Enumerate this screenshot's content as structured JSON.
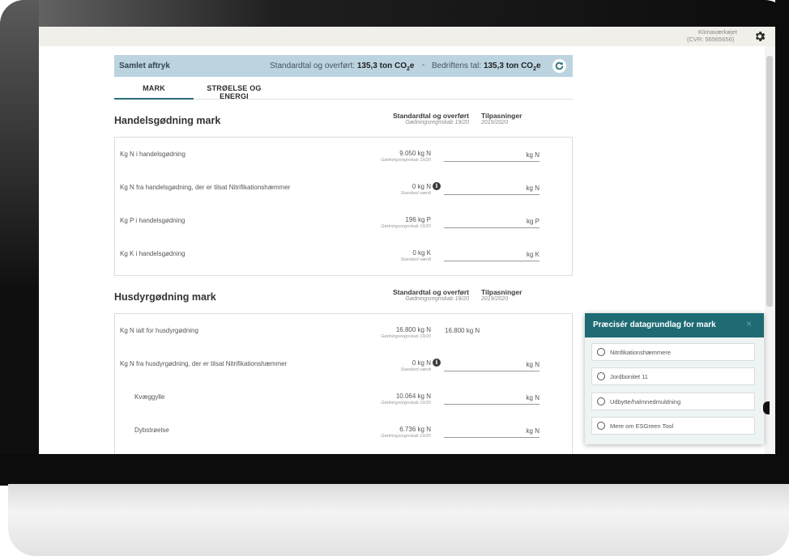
{
  "topbar": {
    "org_name": "Klimaværkøjet",
    "org_cvr": "(CVR: 56565656)"
  },
  "summary": {
    "title": "Samlet aftryk",
    "standard_label": "Standardtal og overført:",
    "standard_value": "135,3 ton CO",
    "separator": "-",
    "firm_label": "Bedriftens tal:",
    "firm_value": "135,3 ton CO",
    "co2_sub": "2",
    "co2_suffix": "e"
  },
  "tabs": [
    {
      "label": "MARK",
      "active": true
    },
    {
      "label": "STRØELSE OG ENERGI",
      "active": false
    }
  ],
  "columns": {
    "std_header": "Standardtal og overført",
    "std_sub": "Gødningsregnskab 19/20",
    "adj_header": "Tilpasninger",
    "adj_sub": "2019/2020"
  },
  "sections": [
    {
      "title": "Handelsgødning mark",
      "rows": [
        {
          "label": "Kg N i handelsgødning",
          "value": "9.050 kg N",
          "source": "Gødningsregnskab 19/20",
          "unit": "kg N"
        },
        {
          "label": "Kg N fra handelsgødning, der er tilsat Nitrifikationshæmmer",
          "value": "0 kg N",
          "source": "Standard værdi",
          "unit": "kg N",
          "info": "i"
        },
        {
          "label": "Kg P i handelsgødning",
          "value": "196 kg P",
          "source": "Gødningsregnskab 19/20",
          "unit": "kg P"
        },
        {
          "label": "Kg K i handelsgødning",
          "value": "0 kg K",
          "source": "Standard værdi",
          "unit": "kg K"
        }
      ]
    },
    {
      "title": "Husdyrgødning mark",
      "rows": [
        {
          "label": "Kg N ialt for husdyrgødning",
          "value": "16.800 kg N",
          "source": "Gødningsregnskab 19/20",
          "plain": "16.800 kg N"
        },
        {
          "label": "Kg N fra husdyrgødning, der er tilsat Nitrifikationshæmmer",
          "value": "0 kg N",
          "source": "Standard værdi",
          "unit": "kg N",
          "info": "i"
        },
        {
          "label": "Kvæggylle",
          "value": "10.064 kg N",
          "source": "Gødningsregnskab 19/20",
          "unit": "kg N"
        },
        {
          "label": "Dybstrøelse",
          "value": "6.736 kg N",
          "source": "Gødningsregnskab 19/20",
          "unit": "kg N"
        }
      ]
    }
  ],
  "popup": {
    "title": "Præcisér datagrundlag for mark",
    "close": "×",
    "options": [
      "Nitrifikationshæmmere",
      "Jordbonitet 11",
      "Udbytte/halmnedmuldning",
      "Mere om ESGreen Tool"
    ]
  },
  "colors": {
    "accent": "#1e6b74",
    "summary_bg": "#bcd4e0",
    "tab_underline": "#2d6f7c"
  }
}
